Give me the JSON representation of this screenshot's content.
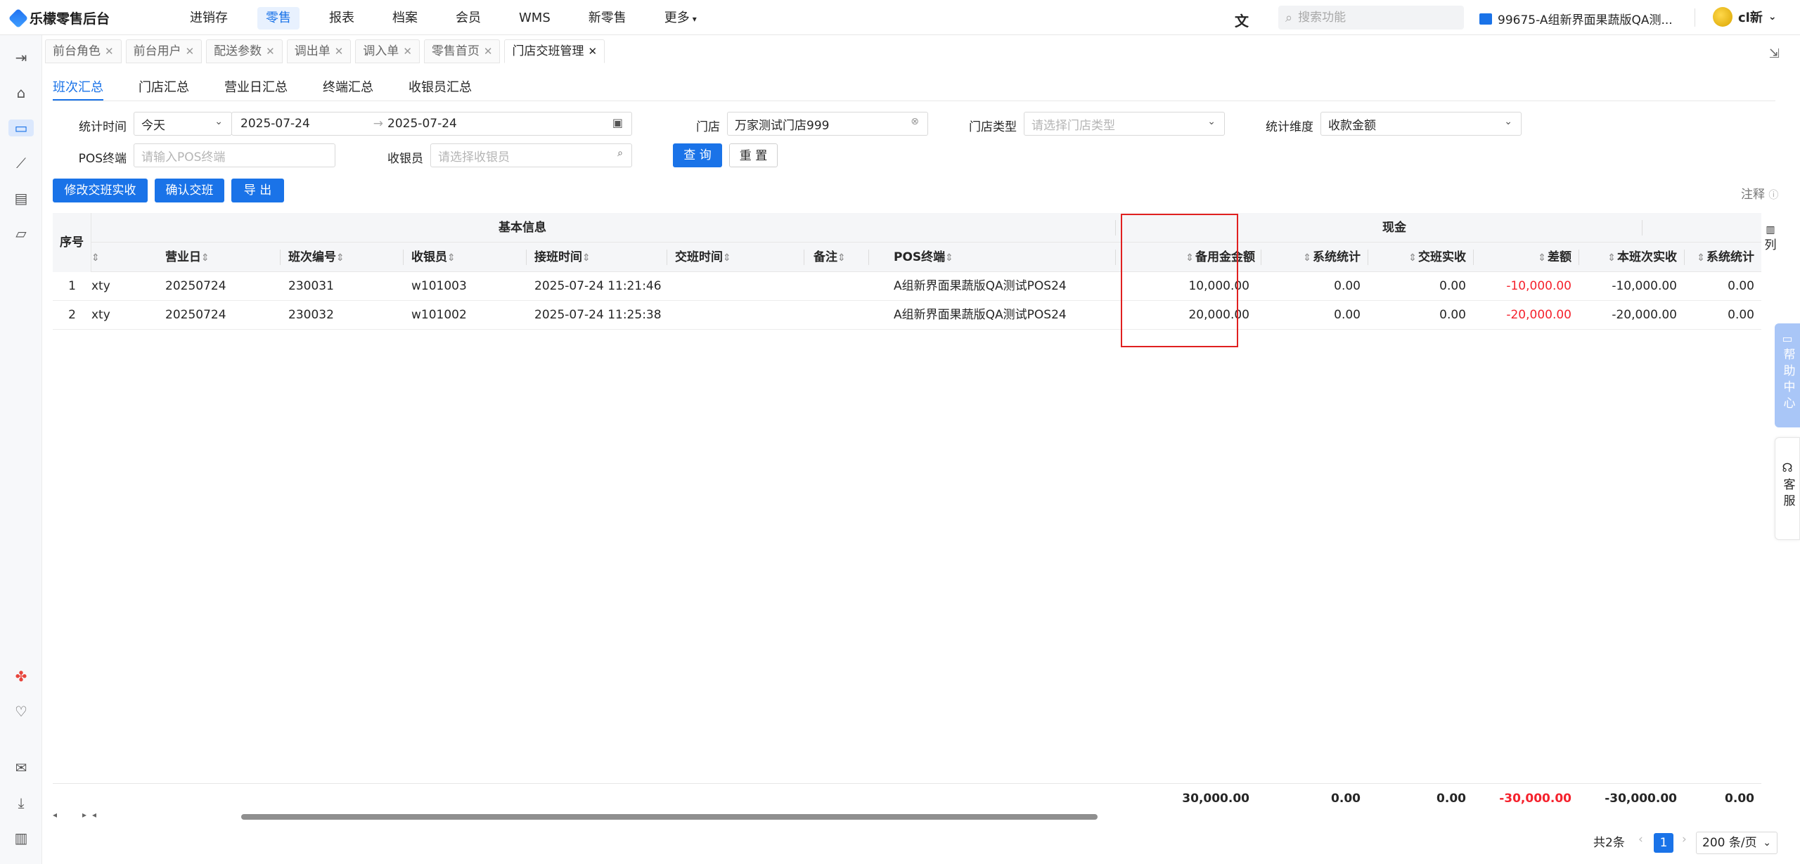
{
  "app": {
    "title": "乐檬零售后台"
  },
  "nav": [
    "进销存",
    "零售",
    "报表",
    "档案",
    "会员",
    "WMS",
    "新零售",
    "更多"
  ],
  "nav_active": 1,
  "header": {
    "search_placeholder": "搜索功能",
    "store": "99675-A组新界面果蔬版QA测...",
    "user": "cl新"
  },
  "tabs": [
    "前台角色",
    "前台用户",
    "配送参数",
    "调出单",
    "调入单",
    "零售首页",
    "门店交班管理"
  ],
  "subtabs": [
    "班次汇总",
    "门店汇总",
    "营业日汇总",
    "终端汇总",
    "收银员汇总"
  ],
  "filters": {
    "stat_time_label": "统计时间",
    "stat_time_value": "今天",
    "date_start": "2025-07-24",
    "date_end": "2025-07-24",
    "store_label": "门店",
    "store_value": "万家测试门店999",
    "store_type_label": "门店类型",
    "store_type_placeholder": "请选择门店类型",
    "dimension_label": "统计维度",
    "dimension_value": "收款金额",
    "pos_label": "POS终端",
    "pos_placeholder": "请输入POS终端",
    "cashier_label": "收银员",
    "cashier_placeholder": "请选择收银员"
  },
  "buttons": {
    "query": "查 询",
    "reset": "重 置",
    "edit_actual": "修改交班实收",
    "confirm": "确认交班",
    "export": "导 出",
    "note": "注释"
  },
  "table": {
    "group_headers": {
      "seq": "序号",
      "basic": "基本信息",
      "cash": "现金"
    },
    "columns": [
      "营业日",
      "班次编号",
      "收银员",
      "接班时间",
      "交班时间",
      "备注",
      "POS终端",
      "备用金金额",
      "系统统计",
      "交班实收",
      "差额",
      "本班次实收",
      "系统统计"
    ],
    "rows": [
      {
        "seq": "1",
        "store": "xty",
        "biz_day": "20250724",
        "shift_no": "230031",
        "cashier": "w101003",
        "start": "2025-07-24 11:21:46",
        "end": "",
        "remark": "",
        "pos": "A组新界面果蔬版QA测试POS24",
        "reserve": "10,000.00",
        "sys": "0.00",
        "actual": "0.00",
        "diff": "-10,000.00",
        "shift_actual": "-10,000.00",
        "sys2": "0.00"
      },
      {
        "seq": "2",
        "store": "xty",
        "biz_day": "20250724",
        "shift_no": "230032",
        "cashier": "w101002",
        "start": "2025-07-24 11:25:38",
        "end": "",
        "remark": "",
        "pos": "A组新界面果蔬版QA测试POS24",
        "reserve": "20,000.00",
        "sys": "0.00",
        "actual": "0.00",
        "diff": "-20,000.00",
        "shift_actual": "-20,000.00",
        "sys2": "0.00"
      }
    ],
    "totals": {
      "reserve": "30,000.00",
      "sys": "0.00",
      "actual": "0.00",
      "diff": "-30,000.00",
      "shift_actual": "-30,000.00",
      "sys2": "0.00"
    },
    "col_toggle": "列"
  },
  "side_widgets": {
    "help": "帮助中心",
    "service": "客服"
  },
  "pagination": {
    "total": "共2条",
    "page": "1",
    "page_size": "200 条/页"
  }
}
